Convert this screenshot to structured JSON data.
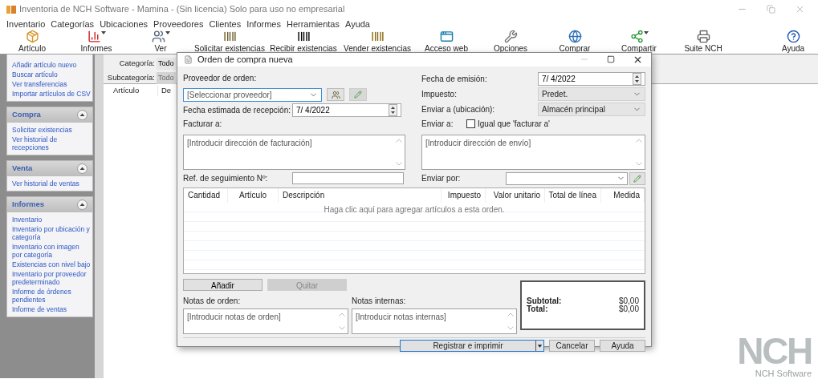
{
  "window": {
    "title": "Inventoria de NCH Software - Mamina - (Sin licencia) Solo para uso no empresarial"
  },
  "menu": [
    "Inventario",
    "Categorías",
    "Ubicaciones",
    "Proveedores",
    "Clientes",
    "Informes",
    "Herramientas",
    "Ayuda"
  ],
  "toolbar": [
    {
      "label": "Artículo",
      "dropdown": false
    },
    {
      "label": "Informes",
      "dropdown": true
    },
    {
      "label": "Ver",
      "dropdown": true
    },
    {
      "label": "Solicitar existencias",
      "dropdown": false
    },
    {
      "label": "Recibir existencias",
      "dropdown": false
    },
    {
      "label": "Vender existencias",
      "dropdown": false
    },
    {
      "label": "Acceso web",
      "dropdown": false
    },
    {
      "label": "Opciones",
      "dropdown": false
    },
    {
      "label": "Comprar",
      "dropdown": false
    },
    {
      "label": "Compartir",
      "dropdown": true
    },
    {
      "label": "Suite NCH",
      "dropdown": false
    },
    {
      "label": "Ayuda",
      "dropdown": false
    }
  ],
  "sidebar": {
    "sections": [
      {
        "expanded": true,
        "items": [
          "Añadir artículo nuevo",
          "Buscar artículo",
          "Ver transferencias",
          "Importar artículos de CSV"
        ]
      },
      {
        "title": "Compra",
        "expanded": true,
        "items": [
          "Solicitar existencias",
          "Ver historial de recepciones"
        ]
      },
      {
        "title": "Venta",
        "expanded": true,
        "items": [
          "Ver historial de ventas"
        ]
      },
      {
        "title": "Informes",
        "expanded": true,
        "items": [
          "Inventario",
          "Inventario por ubicación y categoría",
          "Inventario con imagen por categoría",
          "Existencias con nivel bajo",
          "Inventario por proveedor predeterminado",
          "Informe de órdenes pendientes",
          "Informe de ventas"
        ]
      }
    ]
  },
  "filters": [
    {
      "label": "Categoría:",
      "value": "Todo",
      "disabled": false
    },
    {
      "label": "Subcategoría:",
      "value": "Todo",
      "disabled": true
    }
  ],
  "item_table": {
    "columns": [
      "Artículo",
      "De"
    ]
  },
  "dialog": {
    "title": "Orden de compra nueva",
    "supplier_label": "Proveedor de orden:",
    "supplier_placeholder": "[Seleccionar proveedor]",
    "expected_date_label": "Fecha estimada de recepción:",
    "expected_date": "7/  4/2022",
    "bill_to_label": "Facturar a:",
    "bill_to_placeholder": "[Introducir dirección de facturación]",
    "tracking_label": "Ref. de seguimiento Nº:",
    "issue_date_label": "Fecha de emisión:",
    "issue_date": "7/  4/2022",
    "tax_label": "Impuesto:",
    "tax": "Predet.",
    "ship_location_label": "Enviar a (ubicación):",
    "ship_location": "Almacén principal",
    "ship_to_label": "Enviar a:",
    "same_as_billing": {
      "label": "Igual que 'facturar a'",
      "checked": false
    },
    "ship_to_placeholder": "[Introducir dirección de envío]",
    "ship_via_label": "Enviar por:",
    "lines": {
      "columns": [
        "Cantidad",
        "Artículo",
        "Descripción",
        "Impuesto",
        "Valor unitario",
        "Total de línea",
        "Medida"
      ],
      "empty_hint": "Haga clic aquí para agregar artículos a esta orden."
    },
    "item_buttons": [
      {
        "label": "Añadir",
        "disabled": false
      },
      {
        "label": "Quitar",
        "disabled": true
      }
    ],
    "order_notes_label": "Notas de orden:",
    "order_notes_placeholder": "[Introducir notas de orden]",
    "internal_notes_label": "Notas internas:",
    "internal_notes_placeholder": "[Introducir notas internas]",
    "totals": [
      {
        "label": "Subtotal:",
        "value": "$0,00"
      },
      {
        "label": "Total:",
        "value": "$0,00"
      }
    ],
    "footer_buttons": [
      {
        "label": "Registrar e imprimir",
        "default": true,
        "dropdown": true
      },
      {
        "label": "Cancelar",
        "default": false,
        "dropdown": false
      },
      {
        "label": "Ayuda",
        "default": false,
        "dropdown": false
      }
    ]
  },
  "logo": {
    "mark": "NCH",
    "caption": "NCH Software"
  }
}
